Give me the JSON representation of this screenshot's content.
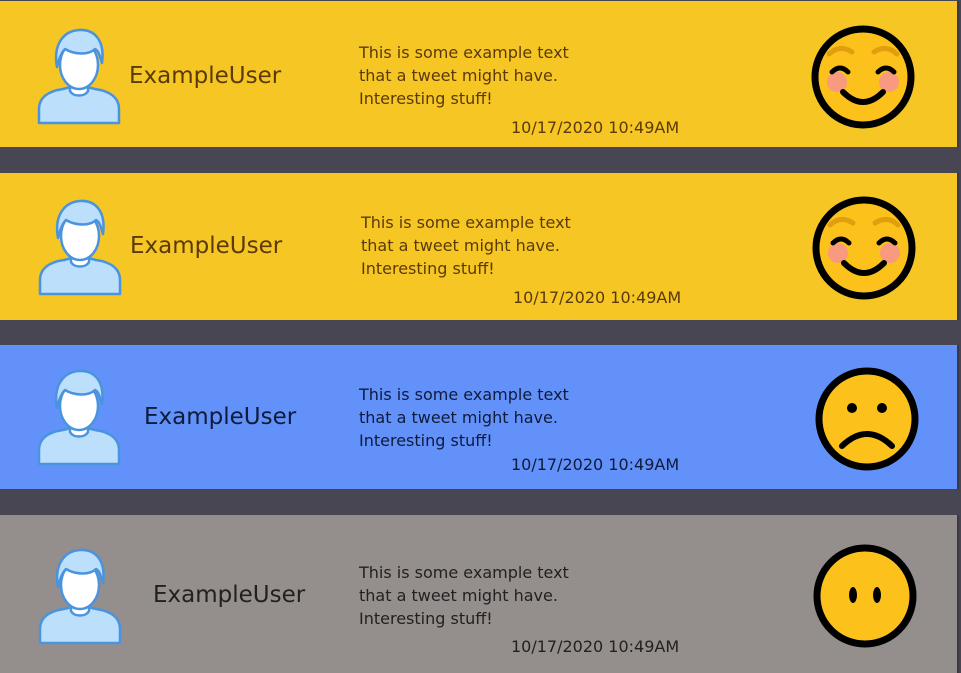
{
  "feed": {
    "tweets": [
      {
        "username": "ExampleUser",
        "text": "This is some example text that a tweet might have. Interesting stuff!",
        "timestamp": "10/17/2020 10:49AM",
        "sentiment": "happy",
        "avatar_icon": "user-avatar-icon",
        "sentiment_icon": "smiling-face-icon",
        "colors": {
          "background": "#F5C624",
          "text": "#5A3A08"
        }
      },
      {
        "username": "ExampleUser",
        "text": "This is some example text that a tweet might have. Interesting stuff!",
        "timestamp": "10/17/2020 10:49AM",
        "sentiment": "happy",
        "avatar_icon": "user-avatar-icon",
        "sentiment_icon": "smiling-face-icon",
        "colors": {
          "background": "#F5C624",
          "text": "#5A3A08"
        }
      },
      {
        "username": "ExampleUser",
        "text": "This is some example text that a tweet might have. Interesting stuff!",
        "timestamp": "10/17/2020 10:49AM",
        "sentiment": "sad",
        "avatar_icon": "user-avatar-icon",
        "sentiment_icon": "frowning-face-icon",
        "colors": {
          "background": "#6391FA",
          "text": "#0E1B3A"
        }
      },
      {
        "username": "ExampleUser",
        "text": "This is some example text that a tweet might have. Interesting stuff!",
        "timestamp": "10/17/2020 10:49AM",
        "sentiment": "neutral",
        "avatar_icon": "user-avatar-icon",
        "sentiment_icon": "neutral-face-icon",
        "colors": {
          "background": "#948E8C",
          "text": "#232120"
        }
      }
    ]
  },
  "colors": {
    "page_background": "#484652",
    "emoji_yellow": "#FCC21B",
    "emoji_outline": "#000000",
    "emoji_cheek": "#F79A80",
    "emoji_brow": "#E19E0E",
    "avatar_fill": "#FFFFFF",
    "avatar_hair": "#BCDFFB",
    "avatar_shirt": "#BCDFFB",
    "avatar_outline": "#4A93DF"
  }
}
